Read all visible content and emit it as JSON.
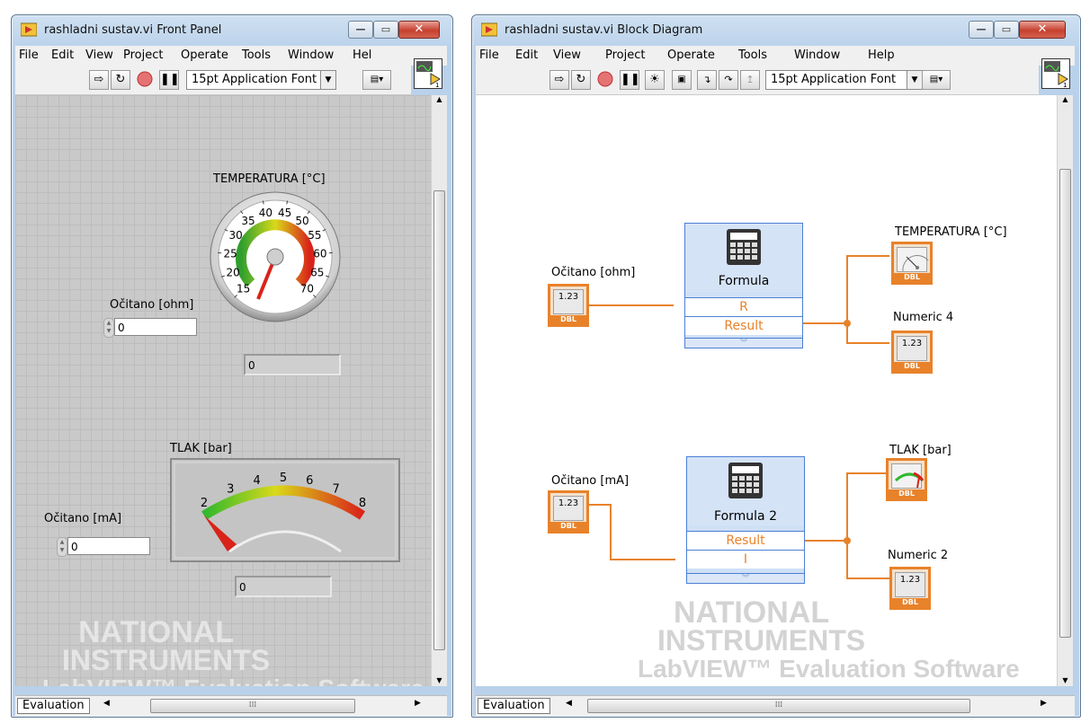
{
  "front_panel": {
    "title": "rashladni sustav.vi Front Panel",
    "menu": [
      "File",
      "Edit",
      "View",
      "Project",
      "Operate",
      "Tools",
      "Window",
      "Hel"
    ],
    "toolbar": {
      "font": "15pt Application Font"
    },
    "temp_gauge": {
      "label": "TEMPERATURA  [°C]",
      "ticks": [
        "15",
        "20",
        "25",
        "30",
        "35",
        "40",
        "45",
        "50",
        "55",
        "60",
        "65",
        "70"
      ],
      "value": 15
    },
    "temp_indicator": {
      "value": "0"
    },
    "ohm_control": {
      "label": "Očitano [ohm]",
      "value": "0"
    },
    "pressure_meter": {
      "label": "TLAK  [bar]",
      "ticks": [
        "2",
        "3",
        "4",
        "5",
        "6",
        "7",
        "8"
      ],
      "value": 2
    },
    "pressure_indicator": {
      "value": "0"
    },
    "ma_control": {
      "label": "Očitano [mA]",
      "value": "0"
    },
    "watermark": {
      "line1": "NATIONAL",
      "line2": "INSTRUMENTS",
      "line3": "LabVIEW™ Evaluation Software"
    },
    "status": {
      "evaluation": "Evaluation"
    }
  },
  "block_diagram": {
    "title": "rashladni sustav.vi Block Diagram",
    "menu": [
      "File",
      "Edit",
      "View",
      "Project",
      "Operate",
      "Tools",
      "Window",
      "Help"
    ],
    "toolbar": {
      "font": "15pt Application Font"
    },
    "ohm_terminal": {
      "label": "Očitano [ohm]",
      "value": "1.23",
      "type": "DBL"
    },
    "formula1": {
      "name": "Formula",
      "input": "R",
      "output": "Result"
    },
    "temp_terminal": {
      "label": "TEMPERATURA  [°C]",
      "type": "DBL"
    },
    "numeric4": {
      "label": "Numeric 4",
      "value": "1.23",
      "type": "DBL"
    },
    "ma_terminal": {
      "label": "Očitano [mA]",
      "value": "1.23",
      "type": "DBL"
    },
    "formula2": {
      "name": "Formula 2",
      "output": "Result",
      "input": "I"
    },
    "tlak_terminal": {
      "label": "TLAK  [bar]",
      "type": "DBL"
    },
    "numeric2": {
      "label": "Numeric 2",
      "value": "1.23",
      "type": "DBL"
    },
    "watermark": {
      "line1": "NATIONAL",
      "line2": "INSTRUMENTS",
      "line3": "LabVIEW™ Evaluation Software"
    },
    "status": {
      "evaluation": "Evaluation"
    }
  },
  "colors": {
    "wire": "#e8822a",
    "node": "#4c7fd6",
    "panel": "#c9c9c9"
  }
}
